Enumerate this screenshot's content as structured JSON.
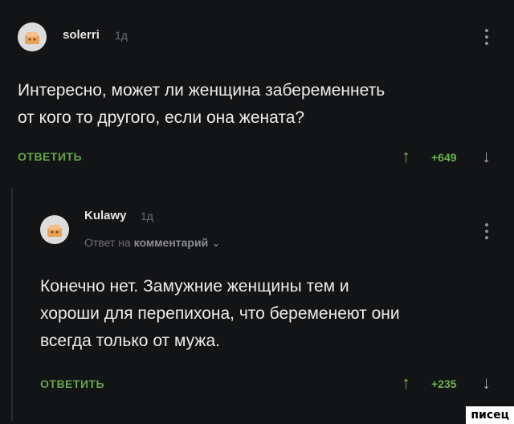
{
  "comments": [
    {
      "username": "solerri",
      "time": "1д",
      "text": "Интересно, может ли женщина забеременнеть\nот кого то другого, если она жената?",
      "reply_label": "ОТВЕТИТЬ",
      "rating": "+649"
    },
    {
      "username": "Kulawy",
      "time": "1д",
      "reply_to_prefix": "Ответ на",
      "reply_to_link": "комментарий",
      "text": "Конечно нет. Замужние женщины тем и\nхороши для перепихона, что беременеют они\nвсегда только от мужа.",
      "reply_label": "ОТВЕТИТЬ",
      "rating": "+235"
    }
  ],
  "icons": {
    "upvote": "↑",
    "downvote": "↓",
    "chevron": "⌄",
    "menu": "more-vertical-icon"
  },
  "watermark": "писец",
  "colors": {
    "background": "#131416",
    "accent_green": "#62a84a",
    "muted_text": "#6d6f73"
  }
}
